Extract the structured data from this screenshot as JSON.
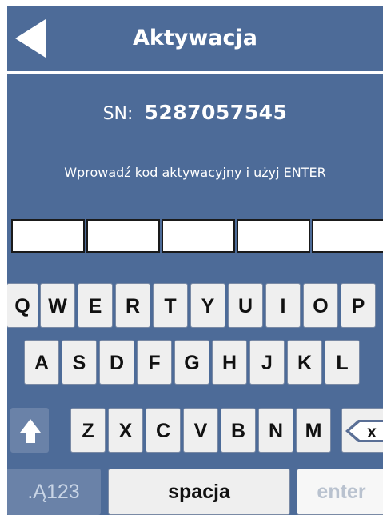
{
  "header": {
    "title": "Aktywacja"
  },
  "serial": {
    "label": "SN:",
    "value": "5287057545"
  },
  "instruction": "Wprowadź kod aktywacyjny i użyj ENTER",
  "code_fields": [
    "",
    "",
    "",
    "",
    ""
  ],
  "keyboard": {
    "row1": [
      "Q",
      "W",
      "E",
      "R",
      "T",
      "Y",
      "U",
      "I",
      "O",
      "P"
    ],
    "row2": [
      "A",
      "S",
      "D",
      "F",
      "G",
      "H",
      "J",
      "K",
      "L"
    ],
    "row3": [
      "Z",
      "X",
      "C",
      "V",
      "B",
      "N",
      "M"
    ],
    "backspace_label": "x",
    "mode_label": ".Ą123",
    "space_label": "spacja",
    "enter_label": "enter"
  },
  "icons": {
    "back": "arrow-left-icon",
    "shift": "shift-arrow-icon",
    "backspace": "backspace-icon"
  },
  "colors": {
    "background": "#4d6b98",
    "key": "#efefef",
    "dark_key": "#6a82a8"
  }
}
